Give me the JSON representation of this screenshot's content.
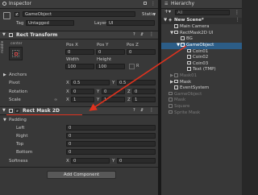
{
  "inspector": {
    "tab_label": "Inspector",
    "object_name": "GameObject",
    "static_label": "Static",
    "tag_label": "Tag",
    "tag_value": "Untagged",
    "layer_label": "Layer",
    "layer_value": "UI",
    "rect_transform": {
      "title": "Rect Transform",
      "anchor_label": "center",
      "middle_label": "middle",
      "pos_x_label": "Pos X",
      "pos_y_label": "Pos Y",
      "pos_z_label": "Pos Z",
      "pos_x": "0",
      "pos_y": "0",
      "pos_z": "0",
      "width_label": "Width",
      "height_label": "Height",
      "width": "100",
      "height": "100",
      "anchors_label": "Anchors",
      "pivot_label": "Pivot",
      "pivot_x": "0.5",
      "pivot_y": "0.5",
      "rotation_label": "Rotation",
      "rot_x": "0",
      "rot_y": "0",
      "rot_z": "0",
      "scale_label": "Scale",
      "scale_x": "1",
      "scale_y": "1",
      "scale_z": "1"
    },
    "rect_mask": {
      "title": "Rect Mask 2D",
      "padding_label": "Padding",
      "left_label": "Left",
      "left": "0",
      "right_label": "Right",
      "right": "0",
      "top_label": "Top",
      "top": "0",
      "bottom_label": "Bottom",
      "bottom": "0",
      "softness_label": "Softness",
      "softness_x": "0",
      "softness_y": "0"
    },
    "add_component_label": "Add Component"
  },
  "hierarchy": {
    "tab_label": "Hierarchy",
    "search_placeholder": "All",
    "items": [
      {
        "label": "New Scene*"
      },
      {
        "label": "Main Camera"
      },
      {
        "label": "RectMask2D UI"
      },
      {
        "label": "BG"
      },
      {
        "label": "GameObject"
      },
      {
        "label": "Coin01"
      },
      {
        "label": "Coin02"
      },
      {
        "label": "Coin03"
      },
      {
        "label": "Text (TMP)"
      },
      {
        "label": "Mask01"
      },
      {
        "label": "Mask"
      },
      {
        "label": "EventSystem"
      },
      {
        "label": "GameObject"
      },
      {
        "label": "Mask"
      },
      {
        "label": "Square"
      },
      {
        "label": "Sprite Mask"
      }
    ]
  },
  "colors": {
    "selected": "#2c5d87",
    "arrow": "#e0321e",
    "accent": "#44a0e8"
  }
}
